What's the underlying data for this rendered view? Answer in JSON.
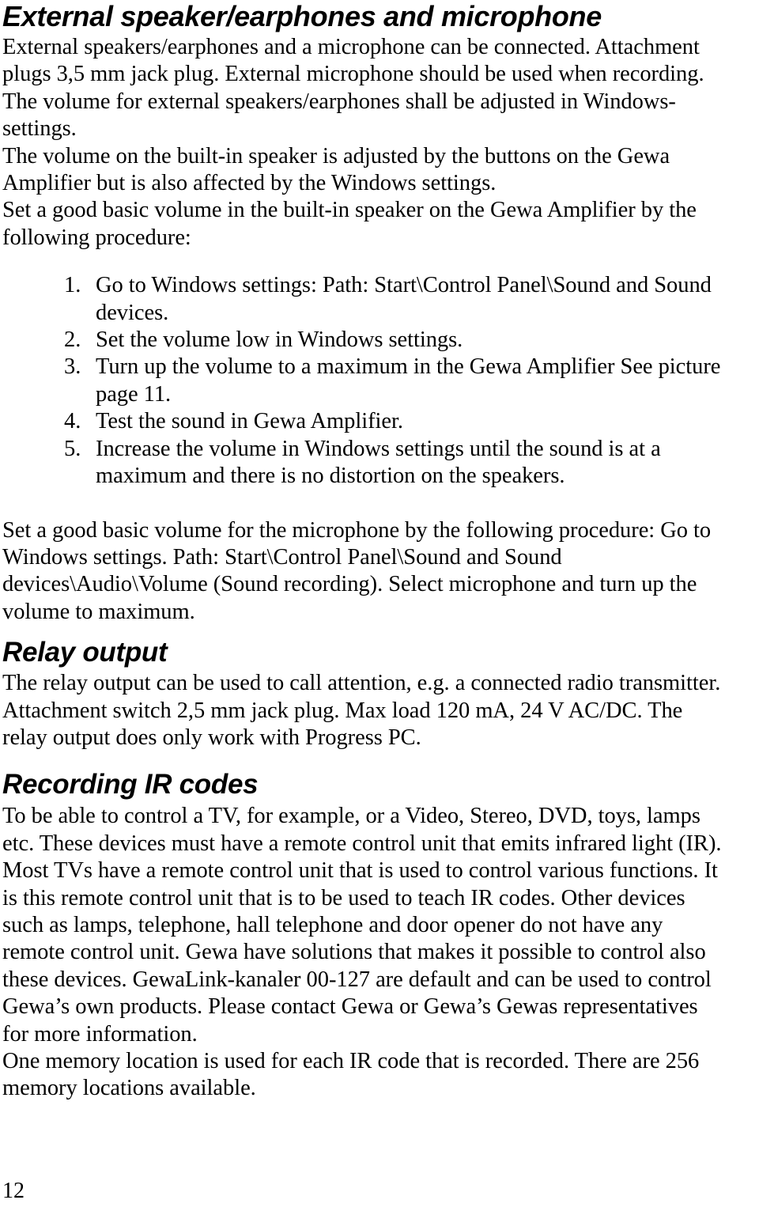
{
  "document": {
    "page_number": "12",
    "sections": [
      {
        "id": "external-speaker",
        "heading": "External speaker/earphones and microphone",
        "lines": [
          "External speakers/earphones and a microphone can be connected. Attachment",
          "plugs 3,5 mm jack plug. External microphone should be used when recording.",
          "The volume for external speakers/earphones shall be adjusted in Windows-",
          "settings.",
          "The volume on the built-in speaker is adjusted by the buttons on the Gewa",
          "Amplifier but is also affected by the Windows settings.",
          "Set a good basic volume in the built-in speaker on the Gewa Amplifier by the",
          "following procedure:"
        ],
        "list": [
          {
            "marker": "1.",
            "lines": [
              "Go to Windows settings: Path: Start\\Control Panel\\Sound and Sound",
              "devices."
            ]
          },
          {
            "marker": "2.",
            "lines": [
              "Set the volume low in Windows settings."
            ]
          },
          {
            "marker": "3.",
            "lines": [
              "Turn up the volume to a maximum in the Gewa Amplifier See picture",
              "page 11."
            ]
          },
          {
            "marker": "4.",
            "lines": [
              "Test the sound in Gewa Amplifier."
            ]
          },
          {
            "marker": "5.",
            "lines": [
              "Increase the volume in Windows settings until the sound is at a",
              "maximum and there is no distortion on the speakers."
            ]
          }
        ],
        "after_list_lines": [
          "Set a good basic volume for the microphone by the following procedure: Go to",
          "Windows settings. Path: Start\\Control Panel\\Sound and Sound",
          "devices\\Audio\\Volume (Sound recording). Select microphone and turn up the",
          "volume to maximum."
        ]
      },
      {
        "id": "relay-output",
        "heading": "Relay output",
        "lines": [
          "The relay output can be used to call attention, e.g. a connected radio transmitter.",
          "Attachment switch 2,5 mm jack plug. Max load 120 mA, 24 V AC/DC. The",
          "relay output does only work with Progress PC."
        ]
      },
      {
        "id": "recording-ir-codes",
        "heading": "Recording IR codes",
        "lines": [
          "To be able to control a TV, for example, or a Video, Stereo, DVD, toys, lamps",
          "etc. These devices must have a remote control unit that emits infrared light (IR).",
          "Most TVs have a remote control unit that is used to control various functions. It",
          "is this remote control unit that is to be used to teach IR codes. Other devices",
          "such as lamps, telephone, hall telephone and door opener do not have any",
          "remote control unit. Gewa have solutions that makes it possible to control also",
          "these devices. GewaLink-kanaler 00-127 are default and can be used to control",
          "Gewa’s own products. Please contact Gewa or Gewa’s  Gewas representatives",
          "for more information.",
          "One memory location is used for each IR code that is recorded. There are 256",
          "memory locations available."
        ]
      }
    ]
  },
  "colors": {
    "text": "#000000",
    "background": "#ffffff"
  }
}
